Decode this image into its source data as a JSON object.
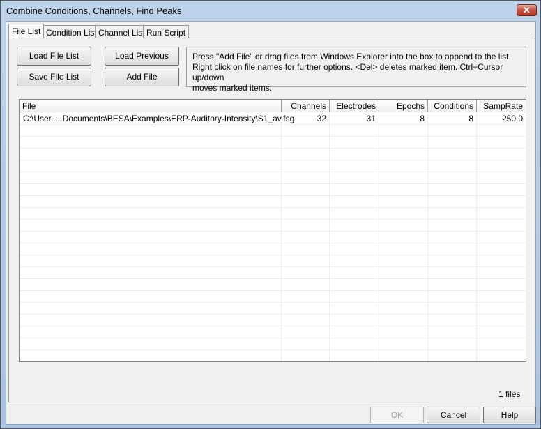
{
  "window": {
    "title": "Combine Conditions, Channels, Find Peaks",
    "close_icon": "close-icon"
  },
  "tabs": [
    {
      "label": "File List",
      "active": true
    },
    {
      "label": "Condition List"
    },
    {
      "label": "Channel List"
    },
    {
      "label": "Run Script"
    }
  ],
  "buttons": {
    "load_file_list": "Load File List",
    "save_file_list": "Save File List",
    "load_previous": "Load Previous",
    "add_file": "Add File"
  },
  "info": {
    "line1": "Press \"Add File\" or drag files from Windows Explorer into the box to append to the list.",
    "line2": "Right click on file names for further options. <Del> deletes marked item. Ctrl+Cursor up/down",
    "line3": "moves marked items."
  },
  "table": {
    "columns": [
      "File",
      "Channels",
      "Electrodes",
      "Epochs",
      "Conditions",
      "SampRate"
    ],
    "rows": [
      [
        "C:\\User.....Documents\\BESA\\Examples\\ERP-Auditory-Intensity\\S1_av.fsg",
        "32",
        "31",
        "8",
        "8",
        "250.0"
      ]
    ]
  },
  "file_count": "1 files",
  "footer": {
    "ok": "OK",
    "ok_enabled": false,
    "cancel": "Cancel",
    "help": "Help"
  }
}
